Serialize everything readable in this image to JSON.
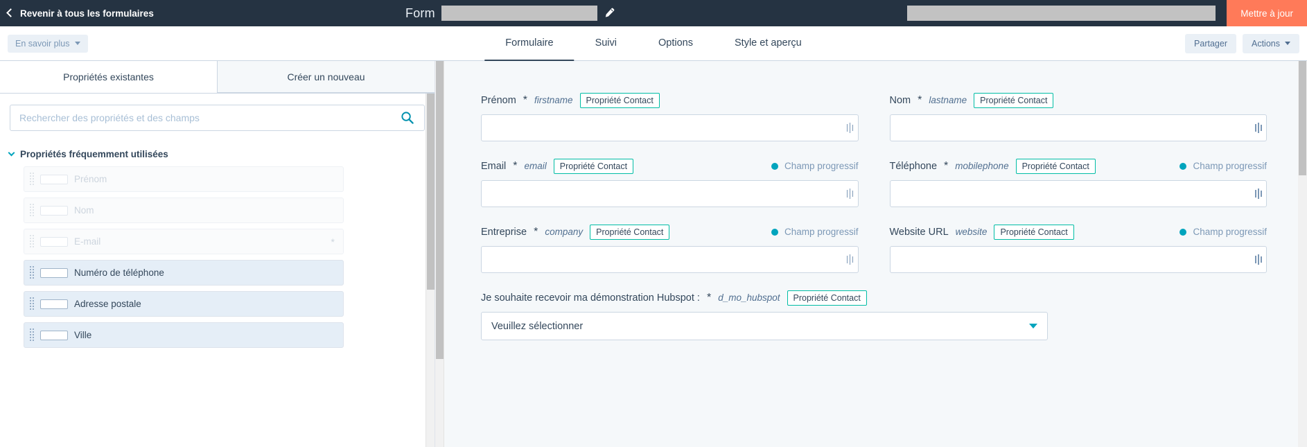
{
  "topbar": {
    "back_label": "Revenir à tous les formulaires",
    "back_icon": "chevron-left-icon",
    "form_title": "Form",
    "edit_icon": "pencil-icon",
    "update_button": "Mettre à jour",
    "accent_orange": "#ff7a59",
    "background": "#253342"
  },
  "tabbar": {
    "learn_more": "En savoir plus",
    "tabs": [
      {
        "label": "Formulaire",
        "active": true
      },
      {
        "label": "Suivi",
        "active": false
      },
      {
        "label": "Options",
        "active": false
      },
      {
        "label": "Style et aperçu",
        "active": false
      }
    ],
    "share_button": "Partager",
    "actions_button": "Actions"
  },
  "sidebar": {
    "tabs": [
      {
        "label": "Propriétés existantes",
        "active": true
      },
      {
        "label": "Créer un nouveau",
        "active": false
      }
    ],
    "search": {
      "placeholder": "Rechercher des propriétés et des champs",
      "value": "",
      "icon": "search-icon"
    },
    "group_title": "Propriétés fréquemment utilisées",
    "items": [
      {
        "label": "Prénom",
        "used": true,
        "required": false
      },
      {
        "label": "Nom",
        "used": true,
        "required": false
      },
      {
        "label": "E-mail",
        "used": true,
        "required": true
      },
      {
        "label": "Numéro de téléphone",
        "used": false,
        "required": false
      },
      {
        "label": "Adresse postale",
        "used": false,
        "required": false
      },
      {
        "label": "Ville",
        "used": false,
        "required": false
      }
    ]
  },
  "canvas": {
    "badge_label": "Propriété Contact",
    "progressive_label": "Champ progressif",
    "teal": "#00bda5",
    "dot_color": "#00a4bd",
    "fields": [
      {
        "label": "Prénom",
        "required": true,
        "internal": "firstname",
        "badge": true,
        "progressive": false,
        "type": "text"
      },
      {
        "label": "Nom",
        "required": true,
        "internal": "lastname",
        "badge": true,
        "progressive": false,
        "type": "text"
      },
      {
        "label": "Email",
        "required": true,
        "internal": "email",
        "badge": true,
        "progressive": true,
        "type": "text"
      },
      {
        "label": "Téléphone",
        "required": true,
        "internal": "mobilephone",
        "badge": true,
        "progressive": true,
        "type": "text"
      },
      {
        "label": "Entreprise",
        "required": true,
        "internal": "company",
        "badge": true,
        "progressive": true,
        "type": "text"
      },
      {
        "label": "Website URL",
        "required": false,
        "internal": "website",
        "badge": true,
        "progressive": true,
        "type": "text"
      }
    ],
    "select_field": {
      "label": "Je souhaite recevoir ma démonstration Hubspot :",
      "required": true,
      "internal": "d_mo_hubspot",
      "badge": true,
      "placeholder": "Veuillez sélectionner"
    }
  }
}
